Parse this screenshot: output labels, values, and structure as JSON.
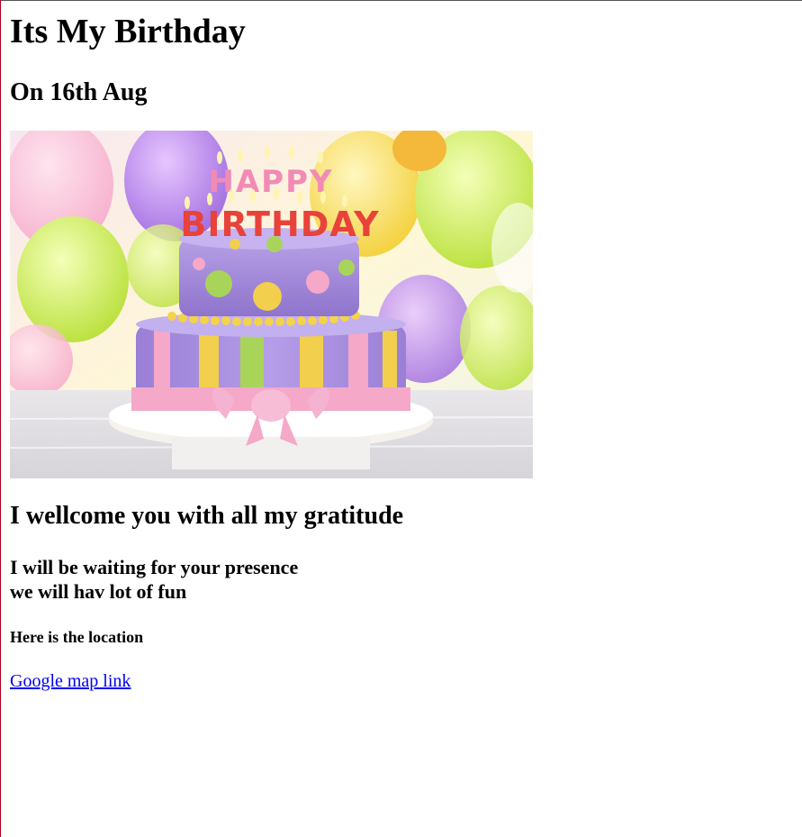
{
  "page": {
    "heading": "Its My Birthday",
    "date": "On 16th Aug",
    "welcome": "I wellcome you with all my gratitude",
    "waiting_line1": "I will be waiting for your presence",
    "waiting_line2": "we will hav lot of fun",
    "location_heading": "Here is the location",
    "map_link": "Google map link"
  },
  "image": {
    "cake_topper_line1": "HAPPY",
    "cake_topper_line2": "BIRTHDAY"
  },
  "colors": {
    "link": "#0000ee",
    "frame_left": "#b00020",
    "cake_top": "#9f86d6",
    "ribbon": "#f5a8c8",
    "stripe_yellow": "#f2cf4c",
    "stripe_green": "#a9d45a"
  }
}
